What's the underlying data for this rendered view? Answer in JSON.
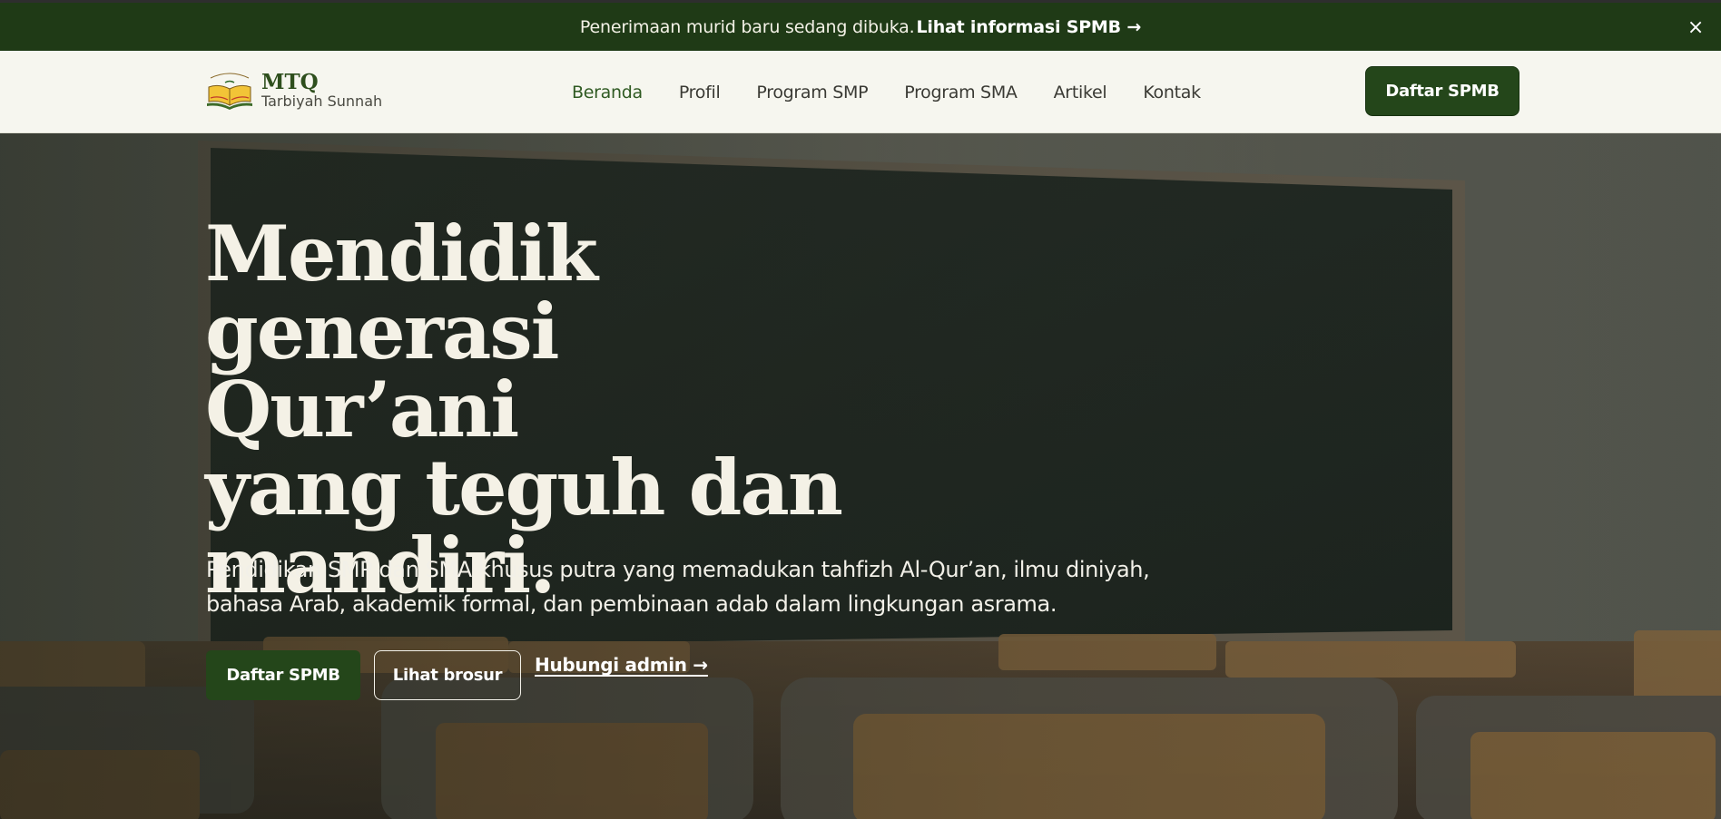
{
  "announcement": {
    "text": "Penerimaan murid baru sedang dibuka.",
    "link": "Lihat informasi SPMB →",
    "close": "×"
  },
  "brand": {
    "name": "MTQ",
    "subtitle": "Tarbiyah Sunnah"
  },
  "nav": {
    "items": [
      "Beranda",
      "Profil",
      "Program SMP",
      "Program SMA",
      "Artikel",
      "Kontak"
    ],
    "active": "Beranda",
    "cta": "Daftar SPMB"
  },
  "hero": {
    "headline_lines": [
      "Mendidik",
      "generasi Qur’ani",
      "yang teguh dan",
      "mandiri."
    ],
    "lead": "Pendidikan SMP dan SMA khusus putra yang memadukan tahfizh Al-Qur’an, ilmu diniyah, bahasa Arab, akademik formal, dan pembinaan adab dalam lingkungan asrama.",
    "primary_button": "Daftar SPMB",
    "secondary_button": "Lihat brosur",
    "link": "Hubungi admin →"
  },
  "colors": {
    "primary": "#24461a",
    "announce_bg": "#1f3a16",
    "accent": "#d87b28",
    "nav_bg": "#f6f6ef"
  }
}
